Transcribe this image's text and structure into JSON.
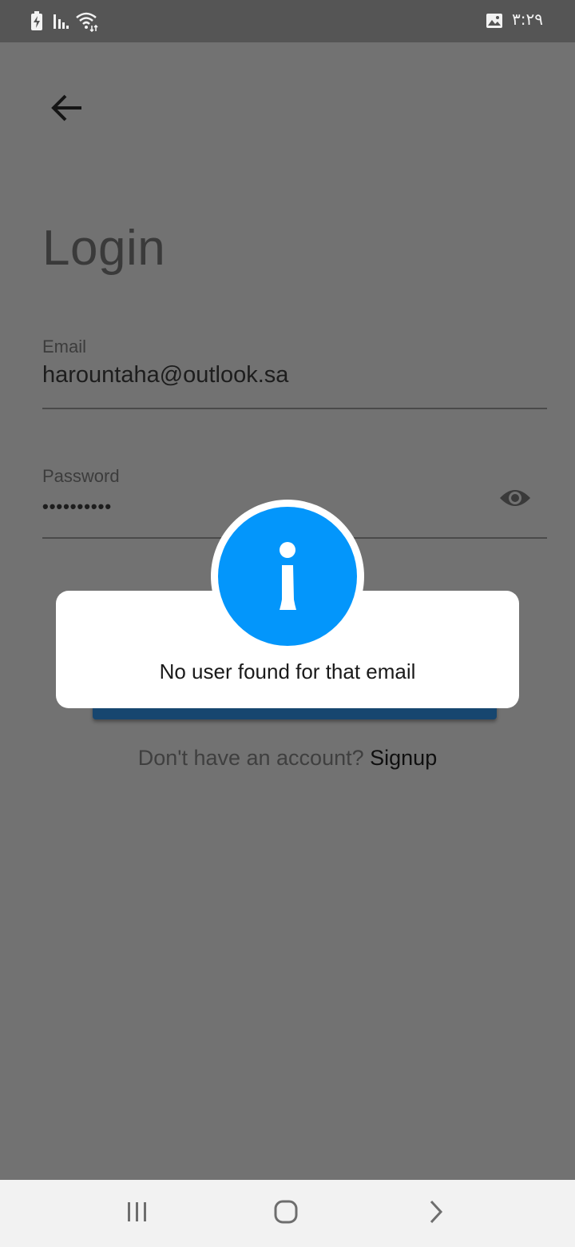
{
  "status_bar": {
    "time": "٣:٢٩",
    "icons": [
      "battery-charging-icon",
      "signal-icon",
      "wifi-icon",
      "image-notification-icon"
    ]
  },
  "header": {
    "back_icon": "arrow-left-icon"
  },
  "page": {
    "title": "Login"
  },
  "form": {
    "email": {
      "label": "Email",
      "value": "harountaha@outlook.sa"
    },
    "password": {
      "label": "Password",
      "value": "••••••••••",
      "toggle_icon": "eye-icon"
    },
    "login_button_color": "#17466f"
  },
  "signup": {
    "prompt": "Don't have an account?",
    "link": "Signup"
  },
  "dialog": {
    "message": "No user found for that email",
    "icon": "info-icon",
    "icon_color": "#0396fb"
  },
  "nav_bar": {
    "icons": [
      "recents-icon",
      "home-icon",
      "back-chevron-icon"
    ]
  }
}
